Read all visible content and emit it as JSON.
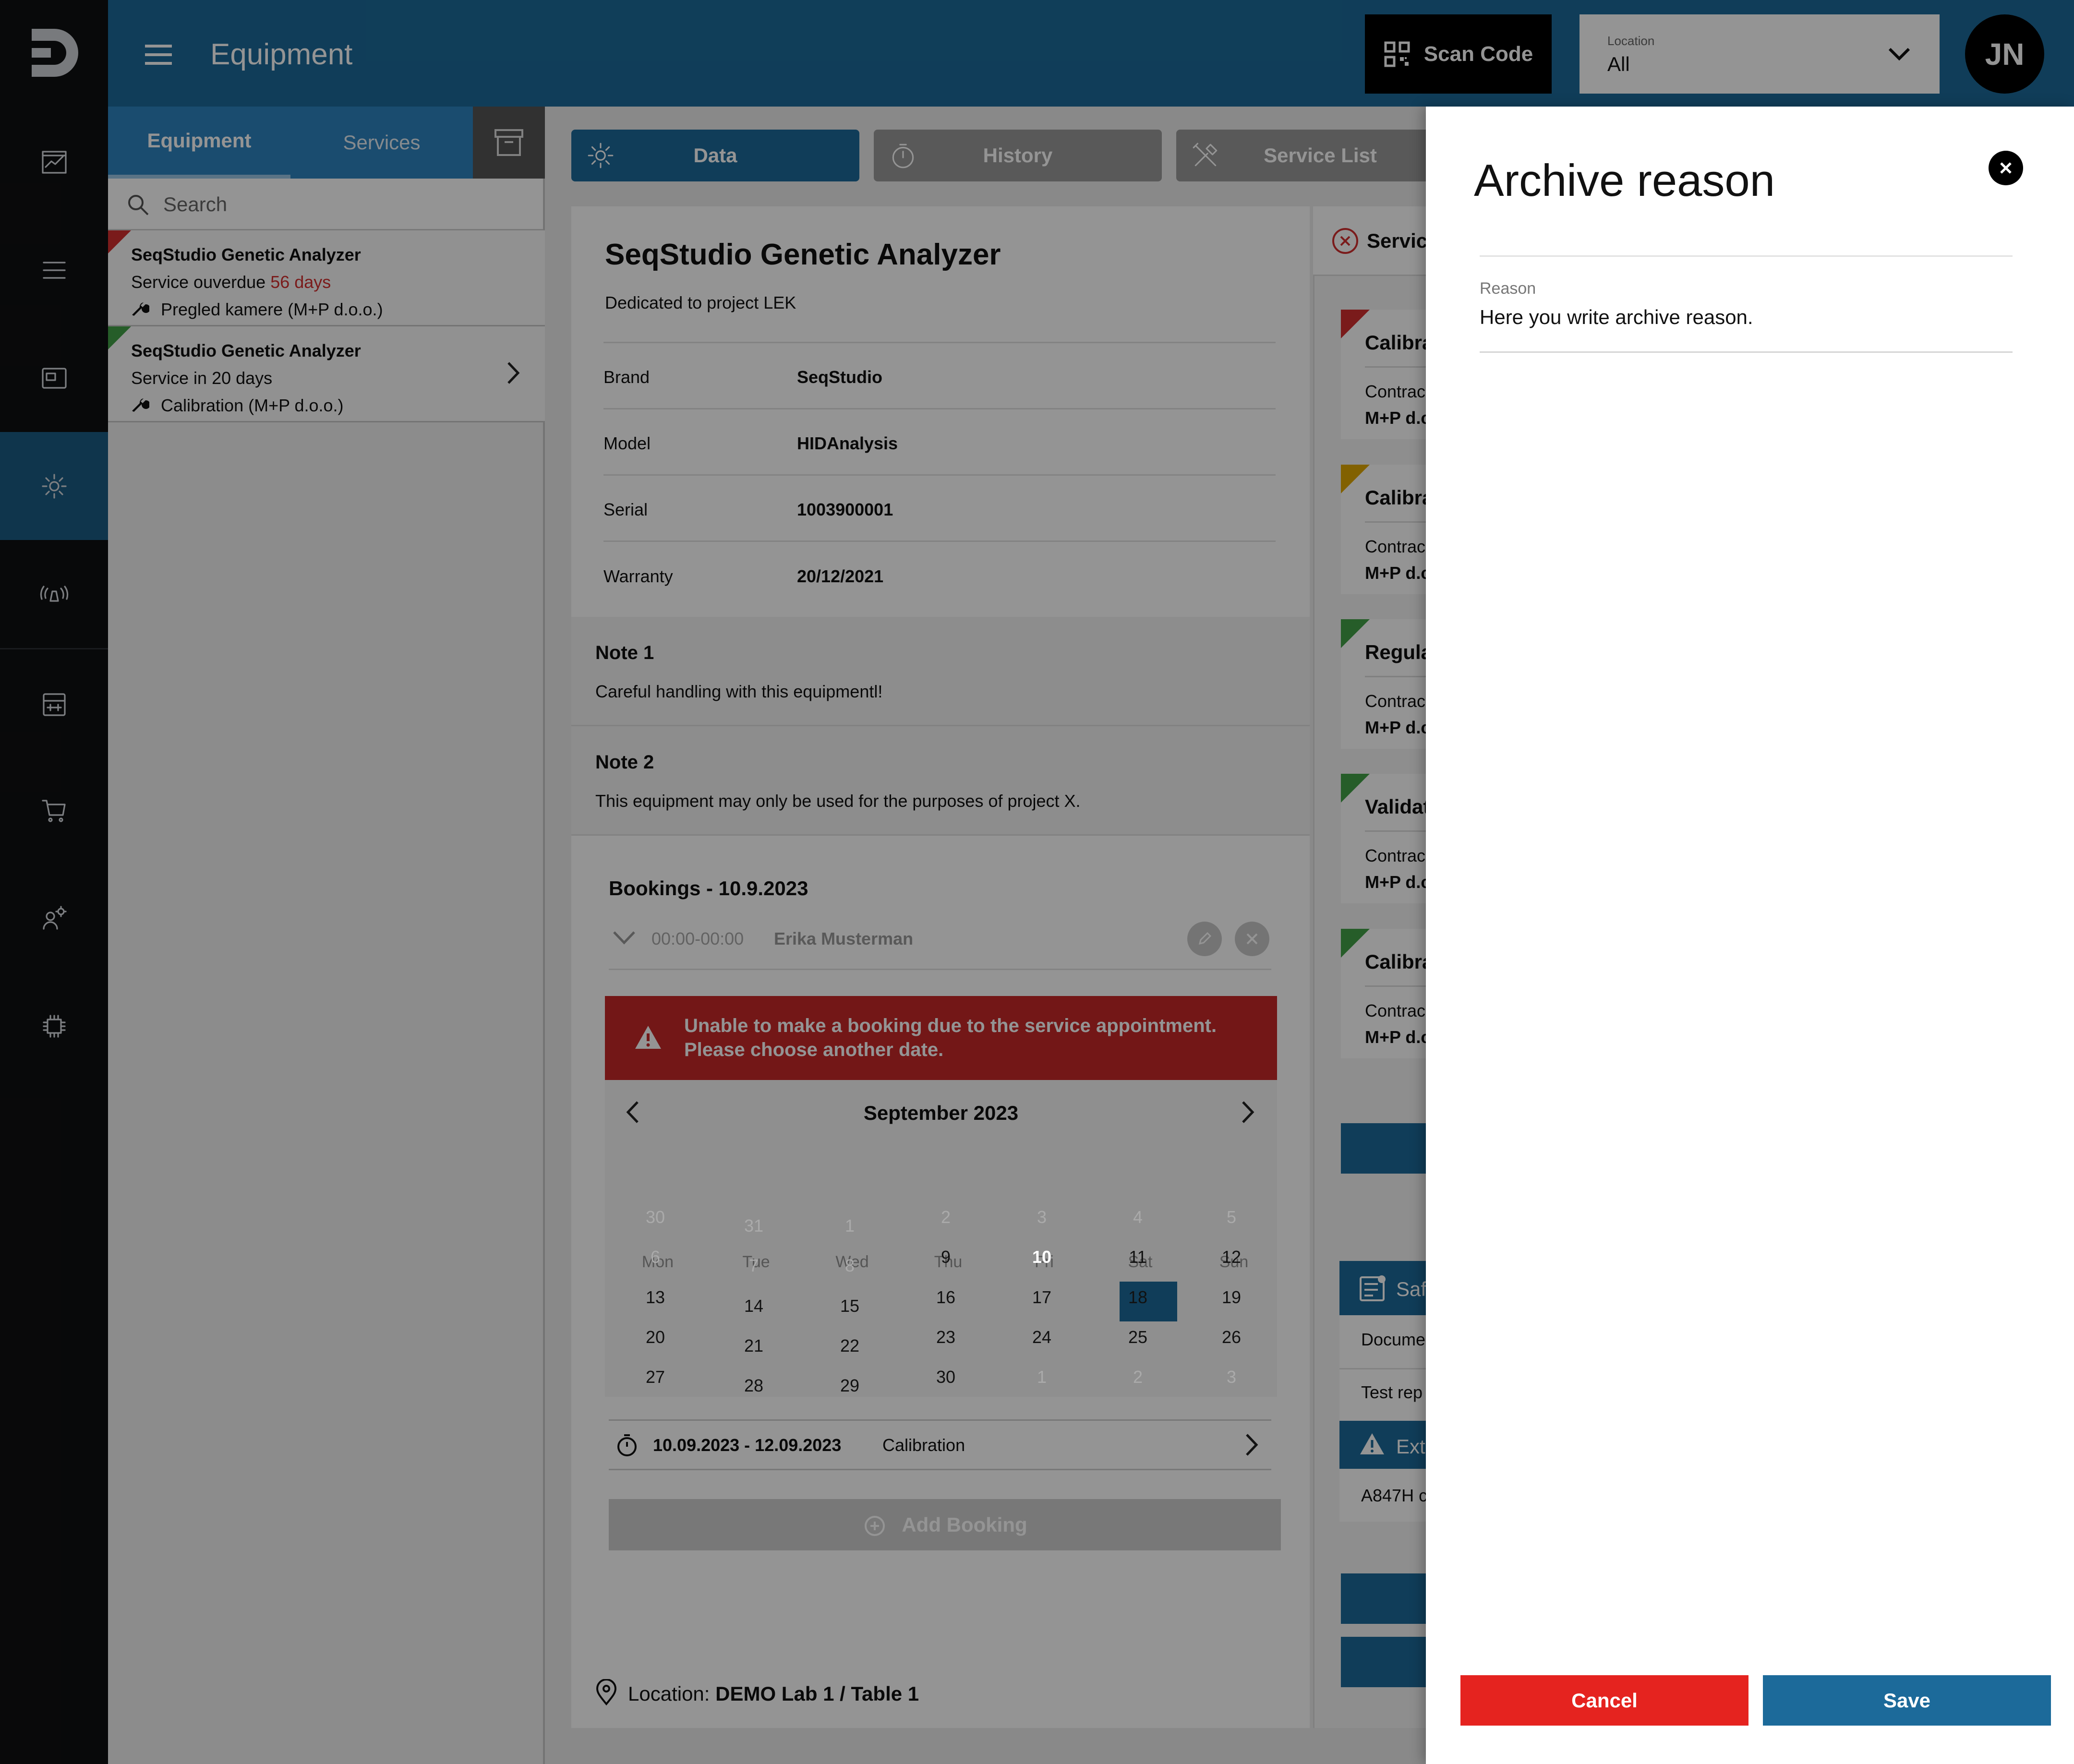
{
  "header": {
    "title": "Equipment",
    "scan_label": "Scan Code",
    "location_label": "Location",
    "location_value": "All",
    "avatar_initials": "JN"
  },
  "left_panel": {
    "tabs": [
      "Equipment",
      "Services"
    ],
    "search_placeholder": "Search",
    "items": [
      {
        "name": "SeqStudio Genetic Analyzer",
        "status_prefix": "Service ouverdue",
        "status_value": "56 days",
        "service": "Pregled kamere (M+P d.o.o.)",
        "flag_color": "#d32f2f"
      },
      {
        "name": "SeqStudio Genetic Analyzer",
        "status_prefix": "Service in 20 days",
        "status_value": "",
        "service": "Calibration (M+P d.o.o.)",
        "flag_color": "#43a047"
      }
    ]
  },
  "tabs": {
    "data": "Data",
    "history": "History",
    "service_list": "Service List"
  },
  "detail": {
    "title": "SeqStudio Genetic Analyzer",
    "subtitle": "Dedicated to project LEK",
    "fields": [
      {
        "label": "Brand",
        "value": "SeqStudio"
      },
      {
        "label": "Model",
        "value": "HIDAnalysis"
      },
      {
        "label": "Serial",
        "value": "1003900001"
      },
      {
        "label": "Warranty",
        "value": "20/12/2021"
      }
    ],
    "note1_title": "Note 1",
    "note1_text": "Careful handling with this equipmentl!",
    "note2_title": "Note 2",
    "note2_text": "This equipment may only be used for the purposes of project X.",
    "bookings_title": "Bookings - 10.9.2023",
    "booking_time": "00:00-00:00",
    "booking_person": "Erika Musterman",
    "alert_line1": "Unable to make a booking due to the service appointment.",
    "alert_line2": "Please choose another date.",
    "calendar_month": "September 2023",
    "weekdays": [
      "Mon",
      "Tue",
      "Wed",
      "Thu",
      "Fri",
      "Sat",
      "Sun"
    ],
    "range_dates": "10.09.2023 - 12.09.2023",
    "range_type": "Calibration",
    "add_booking": "Add Booking",
    "location_prefix": "Location:",
    "location_value": "DEMO Lab 1 / Table 1"
  },
  "service_column": {
    "header": "Servic",
    "cards": [
      {
        "title": "Calibra",
        "line1": "Contrac",
        "line2": "M+P d.c",
        "flag": "#d32f2f"
      },
      {
        "title": "Calibra",
        "line1": "Contrac",
        "line2": "M+P d.c",
        "flag": "#e0a800"
      },
      {
        "title": "Regula",
        "line1": "Contrac",
        "line2": "M+P d.c",
        "flag": "#43a047"
      },
      {
        "title": "Validat",
        "line1": "Contrac",
        "line2": "M+P d.c",
        "flag": "#43a047"
      },
      {
        "title": "Calibra",
        "line1": "Contrac",
        "line2": "M+P d.c",
        "flag": "#43a047"
      }
    ],
    "safety_title": "Saf",
    "safety_rows": [
      "Docume",
      "Test rep"
    ],
    "ext_title": "Ext",
    "ext_row": "A847H c"
  },
  "dialog": {
    "title": "Archive reason",
    "field_label": "Reason",
    "field_value": "Here you write archive reason.",
    "cancel": "Cancel",
    "save": "Save"
  },
  "colors": {
    "primary": "#1c6a9a",
    "danger": "#e5231f",
    "alert_bg": "#c62828"
  }
}
